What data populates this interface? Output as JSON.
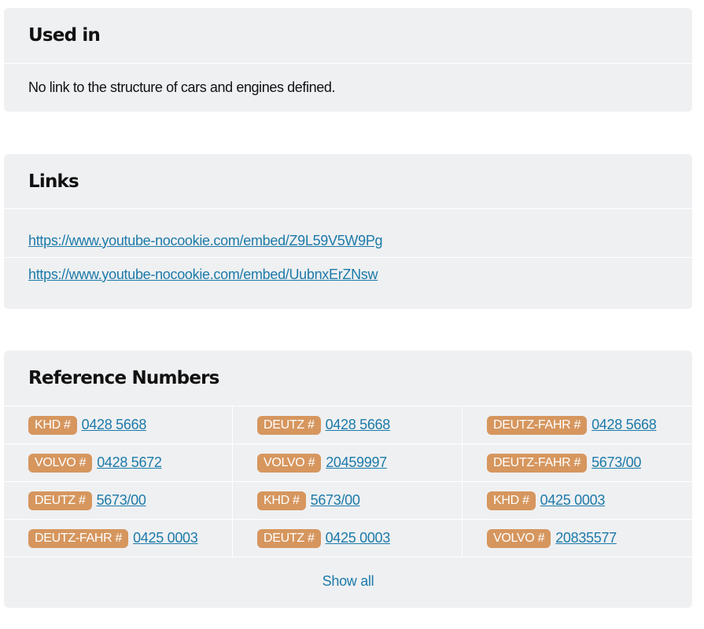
{
  "used_in": {
    "title": "Used in",
    "text": "No link to the structure of cars and engines defined."
  },
  "links": {
    "title": "Links",
    "items": [
      "https://www.youtube-nocookie.com/embed/Z9L59V5W9Pg",
      "https://www.youtube-nocookie.com/embed/UubnxErZNsw"
    ]
  },
  "reference_numbers": {
    "title": "Reference Numbers",
    "items": [
      {
        "brand": "KHD #",
        "number": "0428 5668"
      },
      {
        "brand": "DEUTZ #",
        "number": "0428 5668"
      },
      {
        "brand": "DEUTZ-FAHR #",
        "number": "0428 5668"
      },
      {
        "brand": "VOLVO #",
        "number": "0428 5672"
      },
      {
        "brand": "VOLVO #",
        "number": "20459997"
      },
      {
        "brand": "DEUTZ-FAHR #",
        "number": "5673/00"
      },
      {
        "brand": "DEUTZ #",
        "number": "5673/00"
      },
      {
        "brand": "KHD #",
        "number": "5673/00"
      },
      {
        "brand": "KHD #",
        "number": "0425 0003"
      },
      {
        "brand": "DEUTZ-FAHR #",
        "number": "0425 0003"
      },
      {
        "brand": "DEUTZ #",
        "number": "0425 0003"
      },
      {
        "brand": "VOLVO #",
        "number": "20835577"
      }
    ],
    "show_all_label": "Show all"
  },
  "colors": {
    "card_background": "#eff0f2",
    "badge": "#d6965e",
    "link": "#1c7aa9"
  }
}
